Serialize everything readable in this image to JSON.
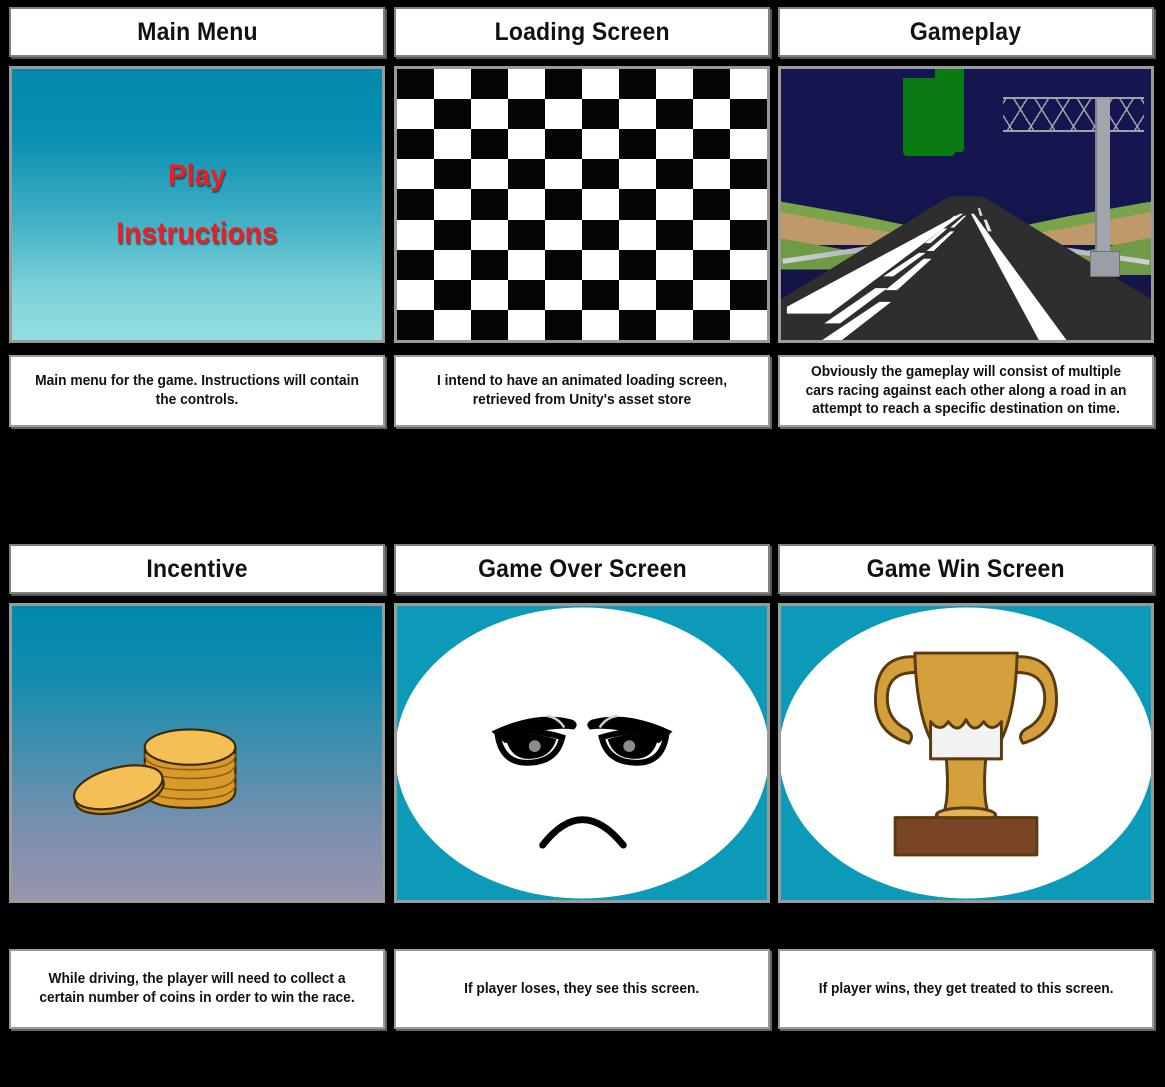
{
  "storyboard": {
    "rows": [
      {
        "cells": [
          {
            "title": "Main Menu",
            "caption": "Main menu for the game. Instructions will contain the controls.",
            "art": "main-menu",
            "menu_options": [
              "Play",
              "Instructions"
            ],
            "colors": {
              "gradient_top": "#0089ac",
              "gradient_bottom": "#93dfdf",
              "option_text": "#ef1c23"
            }
          },
          {
            "title": "Loading Screen",
            "caption": "I intend to have an animated loading screen, retrieved from Unity's asset store",
            "art": "checkerboard",
            "checker": {
              "columns": 10,
              "rows": 9,
              "dark": "#050505",
              "light": "#ffffff"
            }
          },
          {
            "title": "Gameplay",
            "caption": "Obviously the gameplay will consist of multiple cars racing against each other along a road in an attempt to reach a specific destination on time.",
            "art": "highway-scene",
            "colors": {
              "sky": "#151550",
              "sign": "#0a7a13",
              "road": "#2e2e2e",
              "grass": "#79a44a",
              "cliff": "#c0996a"
            }
          }
        ]
      },
      {
        "cells": [
          {
            "title": "Incentive",
            "caption": "While driving, the player will need to collect a certain number of coins in order to win the race.",
            "art": "coin-stack",
            "colors": {
              "gradient_top": "#0089ad",
              "gradient_bottom": "#9695ad",
              "coin_face": "#f5bf55",
              "coin_edge": "#b5801f"
            }
          },
          {
            "title": "Game Over Screen",
            "caption": "If player loses, they see this screen.",
            "art": "sad-face",
            "colors": {
              "background": "#0c9ab8",
              "face": "#ffffff",
              "features": "#000000"
            }
          },
          {
            "title": "Game Win Screen",
            "caption": "If player wins, they get treated to this screen.",
            "art": "trophy",
            "colors": {
              "background": "#0c9ab8",
              "face": "#ffffff",
              "cup": "#d4a03c",
              "base": "#7a4526"
            }
          }
        ]
      }
    ]
  }
}
